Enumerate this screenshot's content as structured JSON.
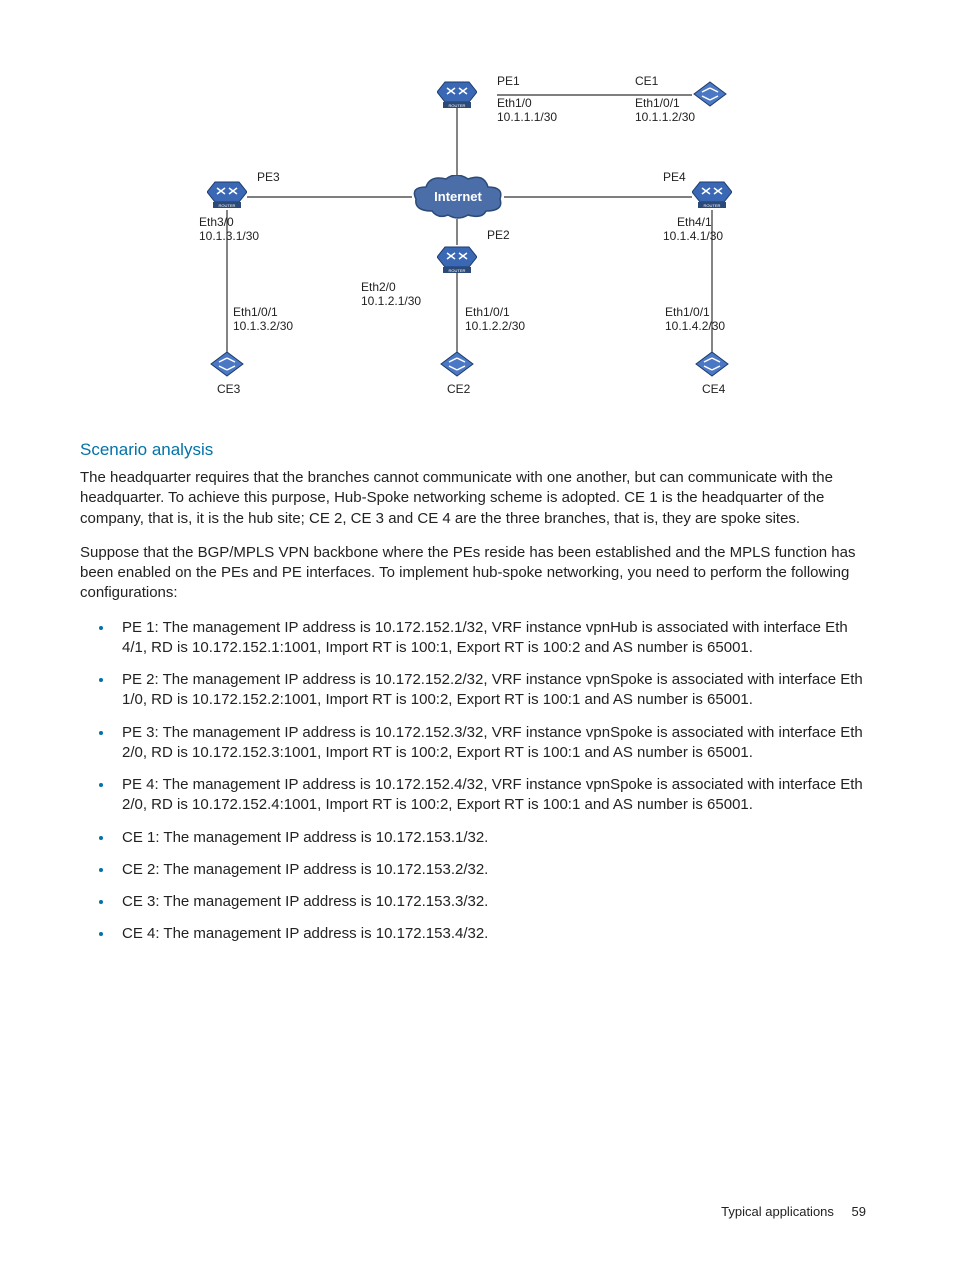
{
  "diagram": {
    "internet_label": "Internet",
    "nodes": {
      "PE1": {
        "name": "PE1",
        "iface": "Eth1/0",
        "ip": "10.1.1.1/30"
      },
      "PE2": {
        "name": "PE2",
        "iface": "Eth2/0",
        "ip": "10.1.2.1/30"
      },
      "PE3": {
        "name": "PE3",
        "iface": "Eth3/0",
        "ip": "10.1.3.1/30"
      },
      "PE4": {
        "name": "PE4",
        "iface": "Eth4/1",
        "ip": "10.1.4.1/30"
      },
      "CE1": {
        "name": "CE1",
        "iface": "Eth1/0/1",
        "ip": "10.1.1.2/30"
      },
      "CE2": {
        "name": "CE2",
        "iface": "Eth1/0/1",
        "ip": "10.1.2.2/30"
      },
      "CE3": {
        "name": "CE3",
        "iface": "Eth1/0/1",
        "ip": "10.1.3.2/30"
      },
      "CE4": {
        "name": "CE4",
        "iface": "Eth1/0/1",
        "ip": "10.1.4.2/30"
      }
    }
  },
  "heading": "Scenario analysis",
  "para1": "The headquarter requires that the branches cannot communicate with one another, but can communicate with the headquarter. To achieve this purpose, Hub-Spoke networking scheme is adopted. CE 1 is the headquarter of the company, that is, it is the hub site; CE 2, CE 3 and CE 4 are the three branches, that is, they are spoke sites.",
  "para2": "Suppose that the BGP/MPLS VPN backbone where the PEs reside has been established and the MPLS function has been enabled on the PEs and PE interfaces. To implement hub-spoke networking, you need to perform the following configurations:",
  "bullets": [
    "PE 1: The management IP address is 10.172.152.1/32, VRF instance vpnHub is associated with interface Eth 4/1, RD is 10.172.152.1:1001, Import RT is 100:1, Export RT is 100:2 and AS number is 65001.",
    "PE 2: The management IP address is 10.172.152.2/32, VRF instance vpnSpoke is associated with interface Eth 1/0, RD is 10.172.152.2:1001, Import RT is 100:2, Export RT is 100:1 and AS number is 65001.",
    "PE 3: The management IP address is 10.172.152.3/32, VRF instance vpnSpoke is associated with interface Eth 2/0, RD is 10.172.152.3:1001, Import RT is 100:2, Export RT is 100:1 and AS number is 65001.",
    "PE 4: The management IP address is 10.172.152.4/32, VRF instance vpnSpoke is associated with interface Eth 2/0, RD is 10.172.152.4:1001, Import RT is 100:2, Export RT is 100:1 and AS number is 65001.",
    "CE 1: The management IP address is 10.172.153.1/32.",
    "CE 2: The management IP address is 10.172.153.2/32.",
    "CE 3: The management IP address is 10.172.153.3/32.",
    "CE 4: The management IP address is 10.172.153.4/32."
  ],
  "footer": {
    "section": "Typical applications",
    "page": "59"
  }
}
